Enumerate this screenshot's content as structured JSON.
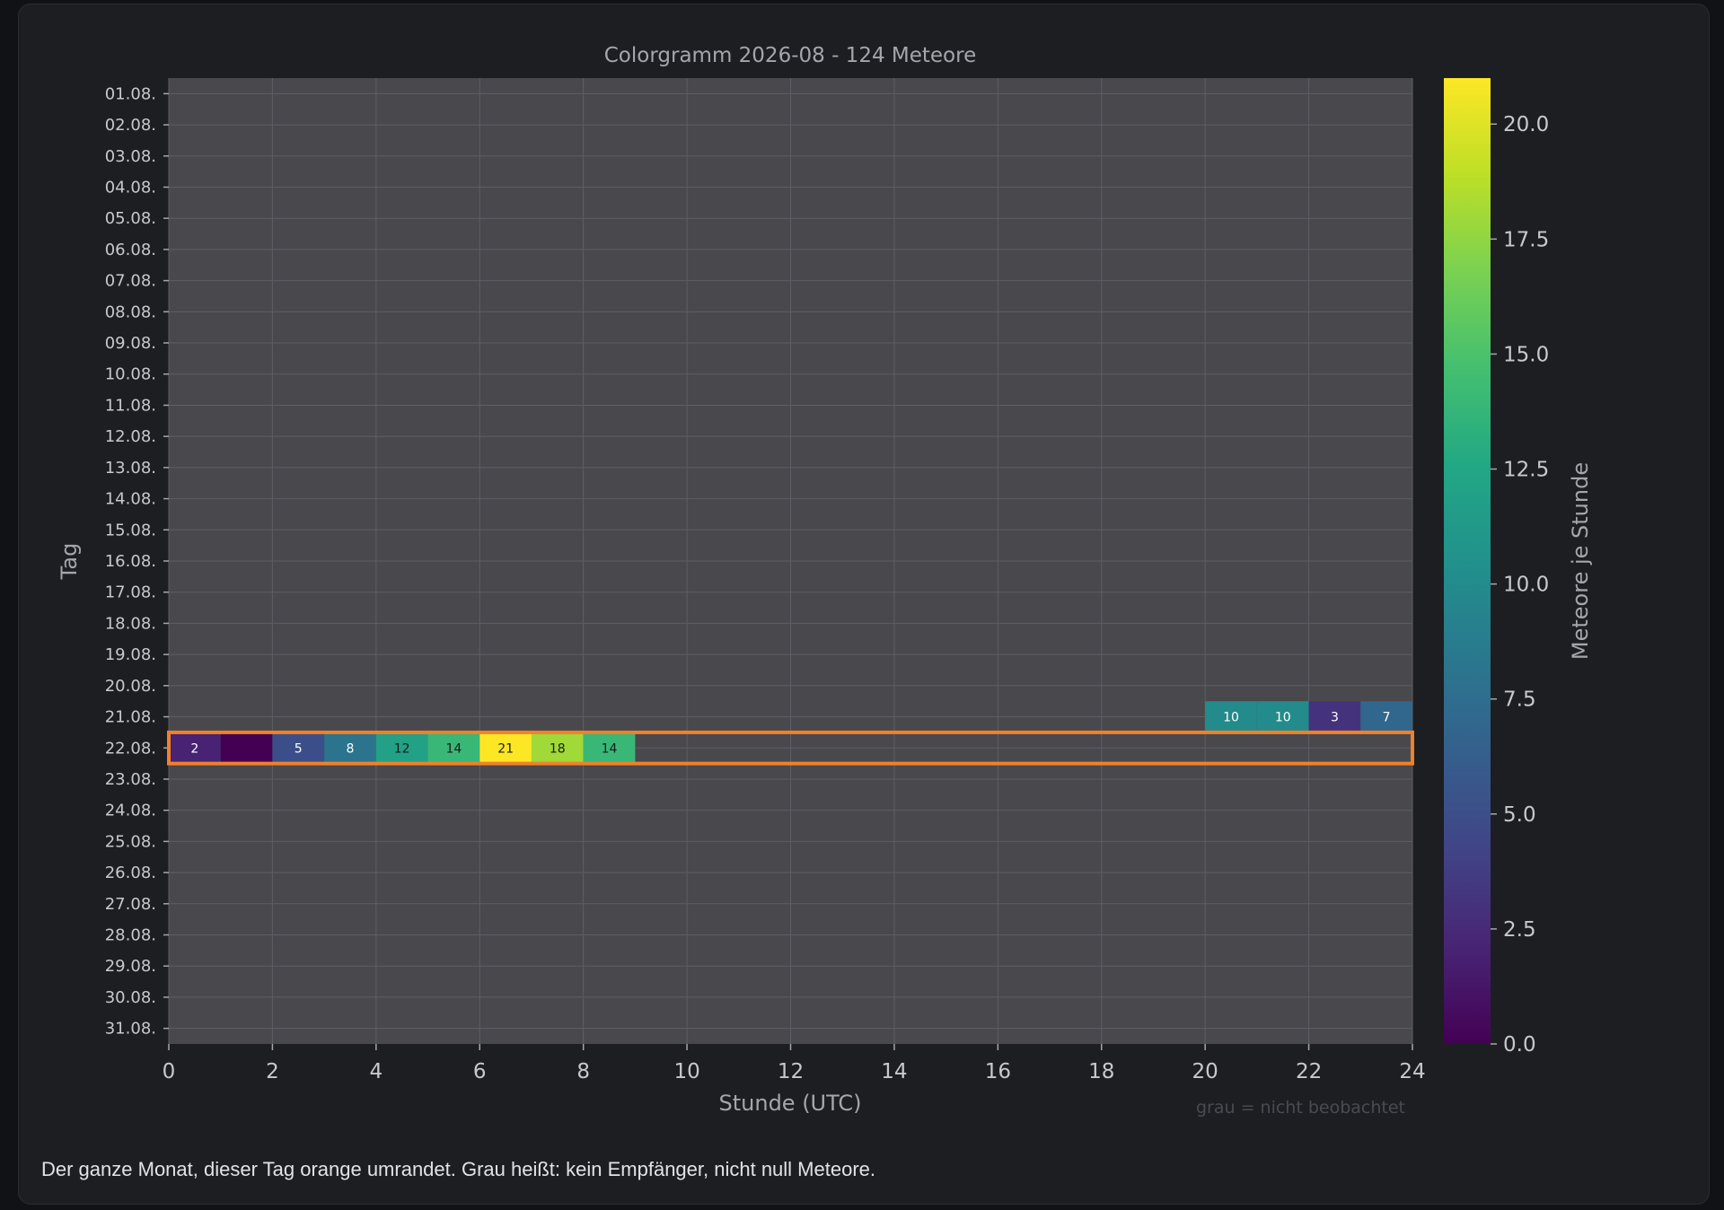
{
  "caption": "Der ganze Monat, dieser Tag orange umrandet. Grau heißt: kein Empfänger, nicht null Meteore.",
  "chart_data": {
    "type": "heatmap",
    "title": "Colorgramm 2026-08 - 124 Meteore",
    "xlabel": "Stunde (UTC)",
    "ylabel": "Tag",
    "colorbar_label": "Meteore je Stunde",
    "colormap": "viridis",
    "note": "grau = nicht beobachtet",
    "xlim": [
      0,
      24
    ],
    "x_ticks": [
      0,
      2,
      4,
      6,
      8,
      10,
      12,
      14,
      16,
      18,
      20,
      22,
      24
    ],
    "y_categories": [
      "01.08.",
      "02.08.",
      "03.08.",
      "04.08.",
      "05.08.",
      "06.08.",
      "07.08.",
      "08.08.",
      "09.08.",
      "10.08.",
      "11.08.",
      "12.08.",
      "13.08.",
      "14.08.",
      "15.08.",
      "16.08.",
      "17.08.",
      "18.08.",
      "19.08.",
      "20.08.",
      "21.08.",
      "22.08.",
      "23.08.",
      "24.08.",
      "25.08.",
      "26.08.",
      "27.08.",
      "28.08.",
      "29.08.",
      "30.08.",
      "31.08."
    ],
    "colorbar_range": [
      0,
      21
    ],
    "colorbar_ticks": [
      "0.0",
      "2.5",
      "5.0",
      "7.5",
      "10.0",
      "12.5",
      "15.0",
      "17.5",
      "20.0"
    ],
    "highlighted_day": "22.08.",
    "highlight_color": "#f0812a",
    "missing_color": "#48484d",
    "grid": true,
    "cells": [
      {
        "day": "21.08.",
        "hour": 20,
        "value": 10
      },
      {
        "day": "21.08.",
        "hour": 21,
        "value": 10
      },
      {
        "day": "21.08.",
        "hour": 22,
        "value": 3
      },
      {
        "day": "21.08.",
        "hour": 23,
        "value": 7
      },
      {
        "day": "22.08.",
        "hour": 0,
        "value": 2
      },
      {
        "day": "22.08.",
        "hour": 1,
        "value": 0
      },
      {
        "day": "22.08.",
        "hour": 2,
        "value": 5
      },
      {
        "day": "22.08.",
        "hour": 3,
        "value": 8
      },
      {
        "day": "22.08.",
        "hour": 4,
        "value": 12
      },
      {
        "day": "22.08.",
        "hour": 5,
        "value": 14
      },
      {
        "day": "22.08.",
        "hour": 6,
        "value": 21
      },
      {
        "day": "22.08.",
        "hour": 7,
        "value": 18
      },
      {
        "day": "22.08.",
        "hour": 8,
        "value": 14
      }
    ]
  }
}
